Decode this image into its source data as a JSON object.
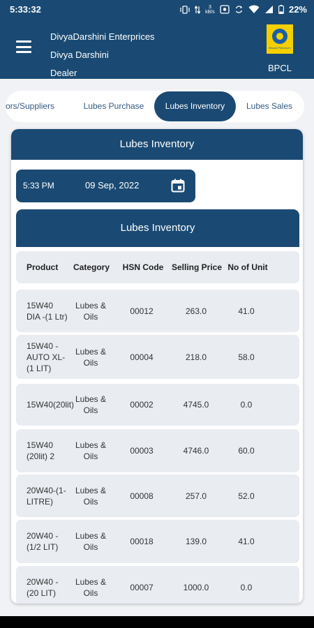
{
  "status_bar": {
    "time": "5:33:32",
    "speed_value": "3",
    "speed_unit": "kB/s",
    "battery": "22%"
  },
  "app_bar": {
    "company": "DivyaDarshini  Enterprices",
    "name": "Divya Darshini",
    "role": "Dealer",
    "brand_label": "BPCL",
    "logo_text": "Bharat Petroleum"
  },
  "tabs": [
    {
      "label": "ors/Suppliers",
      "active": false
    },
    {
      "label": "Lubes Purchase",
      "active": false
    },
    {
      "label": "Lubes Inventory",
      "active": true
    },
    {
      "label": "Lubes Sales",
      "active": false
    }
  ],
  "card": {
    "title": "Lubes Inventory",
    "date_picker": {
      "time": "5:33 PM",
      "date": "09 Sep, 2022",
      "icon": "calendar-icon"
    },
    "inventory_title": "Lubes Inventory"
  },
  "table": {
    "columns": [
      "Product",
      "Category",
      "HSN Code",
      "Selling Price",
      "No of Unit"
    ],
    "rows": [
      {
        "product": "15W40 DIA -(1 Ltr)",
        "category": "Lubes & Oils",
        "hsn": "00012",
        "price": "263.0",
        "units": "41.0"
      },
      {
        "product": "15W40 -AUTO XL-(1 LIT)",
        "category": "Lubes & Oils",
        "hsn": "00004",
        "price": "218.0",
        "units": "58.0"
      },
      {
        "product": "15W40(20lit)",
        "category": "Lubes & Oils",
        "hsn": "00002",
        "price": "4745.0",
        "units": "0.0"
      },
      {
        "product": "15W40 (20lit) 2",
        "category": "Lubes & Oils",
        "hsn": "00003",
        "price": "4746.0",
        "units": "60.0"
      },
      {
        "product": "20W40-(1-LITRE)",
        "category": "Lubes & Oils",
        "hsn": "00008",
        "price": "257.0",
        "units": "52.0"
      },
      {
        "product": "20W40 -(1/2 LIT)",
        "category": "Lubes & Oils",
        "hsn": "00018",
        "price": "139.0",
        "units": "41.0"
      },
      {
        "product": "20W40 -(20 LIT)",
        "category": "Lubes & Oils",
        "hsn": "00007",
        "price": "1000.0",
        "units": "0.0"
      }
    ]
  },
  "colors": {
    "primary": "#1a4a73",
    "background": "#f1f2f5",
    "row_background": "#e9ecf1",
    "logo_yellow": "#f5d000"
  }
}
